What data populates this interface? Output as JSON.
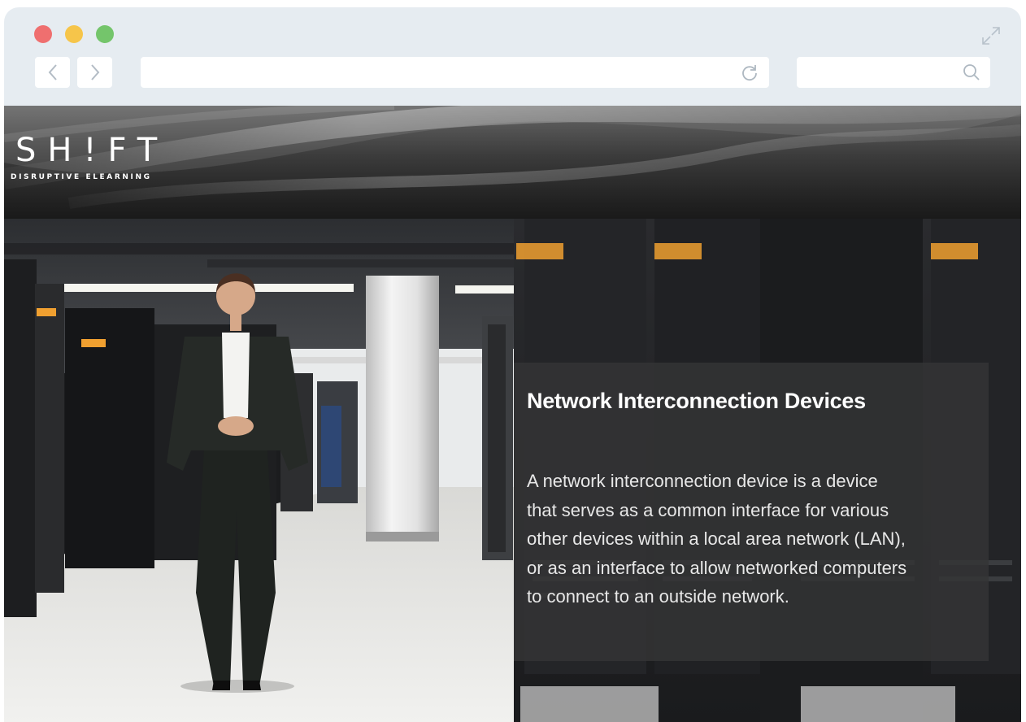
{
  "browser": {
    "icons": {
      "back": "chevron-left-icon",
      "forward": "chevron-right-icon",
      "reload": "reload-icon",
      "search": "search-icon",
      "expand": "expand-icon"
    },
    "address": {
      "value": ""
    },
    "search": {
      "value": ""
    }
  },
  "header": {
    "logo": "SH!FT",
    "tagline": "DISRUPTIVE ELEARNING"
  },
  "content": {
    "title": "Network Interconnection Devices",
    "body_lines": [
      "A network interconnection device is a device",
      "that serves as a common interface for various",
      "other devices within a local area network (LAN),",
      "or as an interface to allow networked computers",
      "to connect to an outside network."
    ]
  },
  "colors": {
    "frame": "#e6ecf1",
    "traffic_red": "#ef6f6f",
    "traffic_yellow": "#f6c54a",
    "traffic_green": "#74c56b",
    "panel_bg": "#343436",
    "accent_orange": "#f0a030"
  }
}
